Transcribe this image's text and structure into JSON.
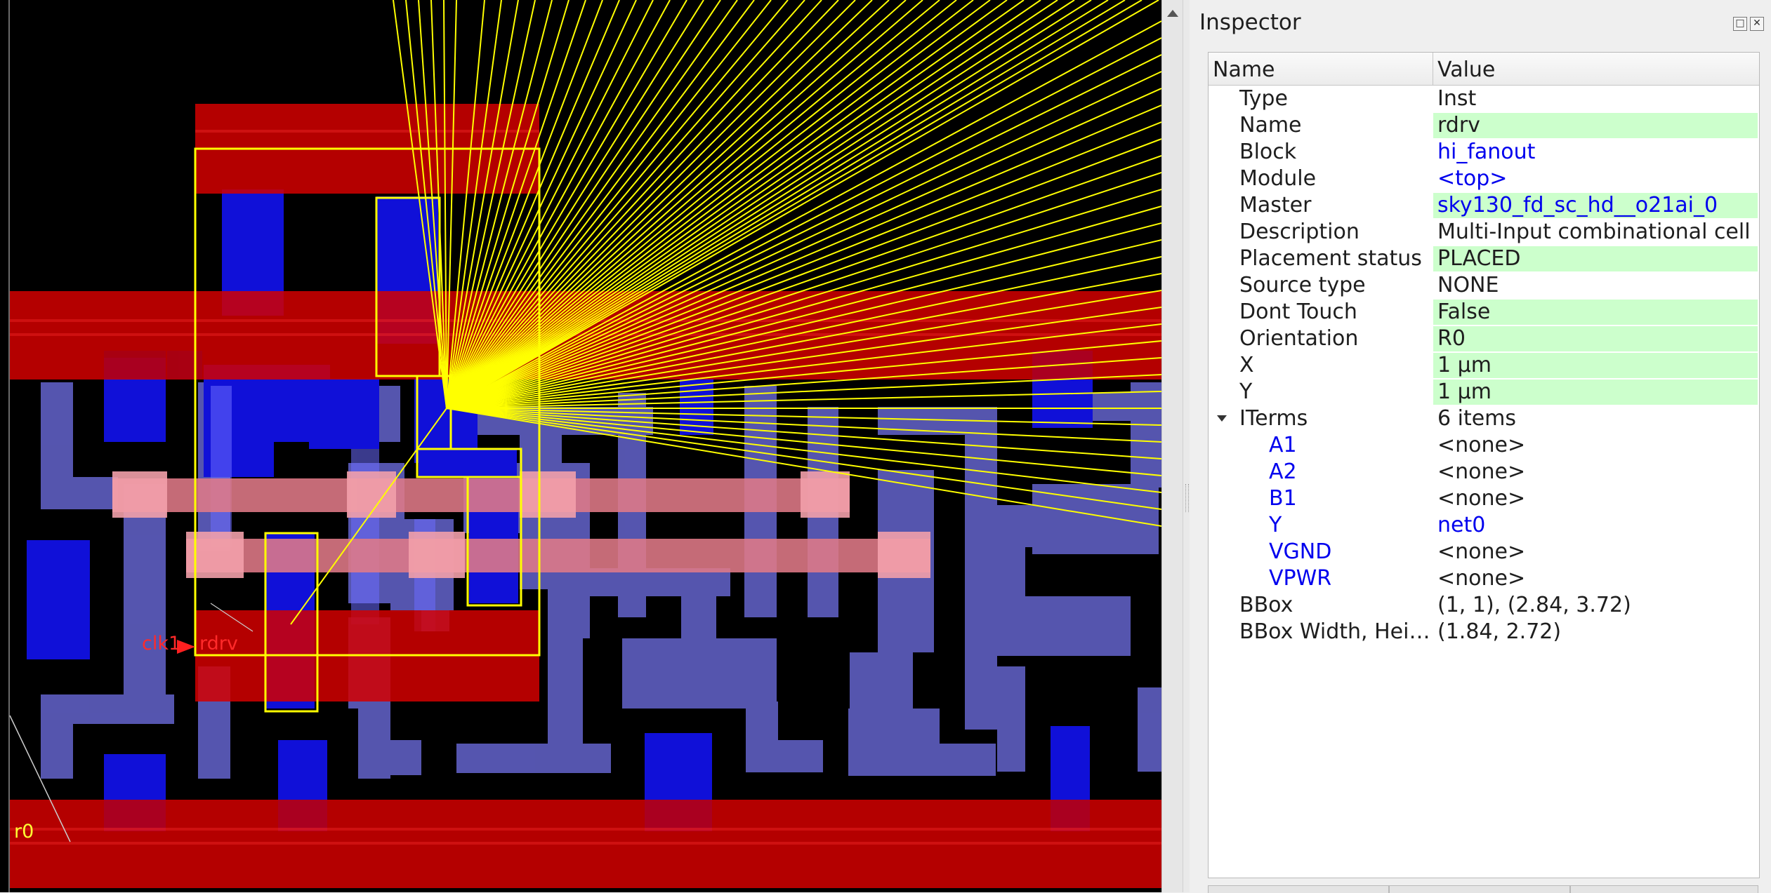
{
  "canvas": {
    "labels": {
      "clk": "clk1",
      "inst": "rdrv",
      "row": "r0"
    }
  },
  "inspector": {
    "title": "Inspector",
    "columns": {
      "name": "Name",
      "value": "Value"
    },
    "props": [
      {
        "name": "Type",
        "value": "Inst",
        "highlight": false,
        "link": false
      },
      {
        "name": "Name",
        "value": "rdrv",
        "highlight": true,
        "link": false
      },
      {
        "name": "Block",
        "value": "hi_fanout",
        "highlight": false,
        "link": true
      },
      {
        "name": "Module",
        "value": "<top>",
        "highlight": false,
        "link": true
      },
      {
        "name": "Master",
        "value": "sky130_fd_sc_hd__o21ai_0",
        "highlight": true,
        "link": true
      },
      {
        "name": "Description",
        "value": "Multi-Input combinational cell",
        "highlight": false,
        "link": false
      },
      {
        "name": "Placement status",
        "value": "PLACED",
        "highlight": true,
        "link": false
      },
      {
        "name": "Source type",
        "value": "NONE",
        "highlight": false,
        "link": false
      },
      {
        "name": "Dont Touch",
        "value": "False",
        "highlight": true,
        "link": false
      },
      {
        "name": "Orientation",
        "value": "R0",
        "highlight": true,
        "link": false
      },
      {
        "name": "X",
        "value": "1 μm",
        "highlight": true,
        "link": false
      },
      {
        "name": "Y",
        "value": "1 μm",
        "highlight": true,
        "link": false
      }
    ],
    "iterms": {
      "name": "ITerms",
      "value": "6 items",
      "items": [
        {
          "name": "A1",
          "value": "<none>",
          "link": false
        },
        {
          "name": "A2",
          "value": "<none>",
          "link": false
        },
        {
          "name": "B1",
          "value": "<none>",
          "link": false
        },
        {
          "name": "Y",
          "value": "net0",
          "link": true
        },
        {
          "name": "VGND",
          "value": "<none>",
          "link": false
        },
        {
          "name": "VPWR",
          "value": "<none>",
          "link": false
        }
      ]
    },
    "bbox": {
      "name": "BBox",
      "value": "(1, 1), (2.84, 3.72)"
    },
    "bbox_wh": {
      "name": "BBox Width, Hei…",
      "value": "(1.84, 2.72)"
    }
  }
}
